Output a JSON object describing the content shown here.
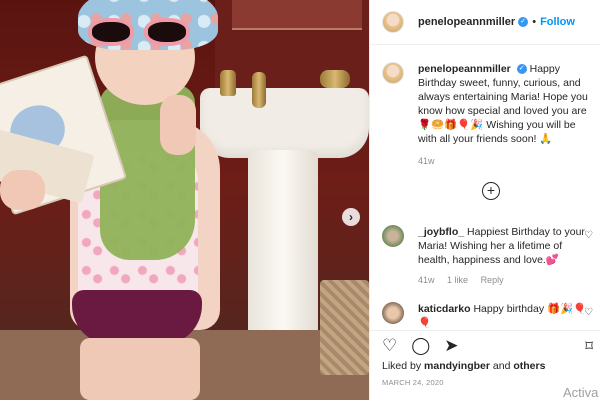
{
  "post": {
    "username": "penelopeannmiller",
    "follow_label": "Follow",
    "dot": "•",
    "caption_user": "penelopeannmiller",
    "caption_text": "Happy Birthday sweet, funny, curious, and always entertaining Maria! Hope you know how special and loved you are🌹🥯🎁🎈🎉 Wishing you will be with all your friends soon! 🙏",
    "caption_time": "41w",
    "more_label": "+"
  },
  "comments": [
    {
      "user": "_joybflo_",
      "text": "Happiest Birthday to your Maria! Wishing her a lifetime of health, happiness and love.💕",
      "time": "41w",
      "likes": "1 like",
      "reply": "Reply"
    },
    {
      "user": "katicdarko",
      "text": "Happy birthday 🎁🎉🎈🎈",
      "time": "",
      "likes": "",
      "reply": ""
    }
  ],
  "footer": {
    "liked_prefix": "Liked by",
    "liked_user": "mandyingber",
    "liked_mid": "and",
    "liked_others": "others",
    "date": "MARCH 24, 2020"
  },
  "icons": {
    "heart": "♡",
    "comment": "◯",
    "share": "➤",
    "bookmark": "⌑",
    "next": "›"
  },
  "watermark": "Activa"
}
